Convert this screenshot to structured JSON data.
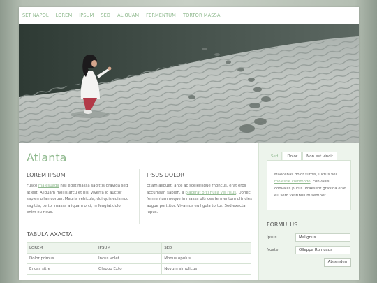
{
  "nav": {
    "items": [
      "SET NAPOL",
      "LOREM",
      "IPSUM",
      "SED",
      "ALIQUAM",
      "FERMENTUM",
      "TORTOR MASSA"
    ]
  },
  "main": {
    "title": "Atlanta",
    "col1": {
      "heading": "LOREM IPSUM",
      "t1": "Fusce ",
      "link": "malesuada",
      "t2": " nisi eget massa sagittis gravida sed at elit. Aliquam mollis arcu et nisi viverra id auctor sapien ullamcorper. Mauris vehicula, dui quis euismod sagittis, tortor massa aliquam orci, in feugiat dolor enim eu risus."
    },
    "col2": {
      "heading": "IPSUS DOLOR",
      "t1": "Etiam aliquet, ante ac scelerisque rhoncus, erat eros accumsan sapien, a ",
      "link": "placerat orci nulla vel risus",
      "t2": ". Donec fermentum neque in massa ultrices fermentum ultricies augue porttitor. Vivamus eu ligula tortor. Sed exacta lupus."
    },
    "table": {
      "title": "TABULA AXACTA",
      "headers": [
        "LOREM",
        "IPSUM",
        "SED"
      ],
      "rows": [
        [
          "Dolor primus",
          "Incus volet",
          "Monus opulus"
        ],
        [
          "Encas sitre",
          "Oleppo Exto",
          "Novum simplicus"
        ]
      ]
    }
  },
  "sidebar": {
    "tabs": [
      "Sed",
      "Dolor",
      "Non est vincit"
    ],
    "tab_text1": "Maecenas dolor turpis, luctus vel ",
    "tab_link": "molestie commodo",
    "tab_text2": ", convallis convallis purus. Praesent gravida erat eu sem vestibulum semper.",
    "form": {
      "title": "FORMULUS",
      "label1": "Ipsus",
      "value1": "Malignus",
      "label2": "Noxte",
      "value2": "Olleppa Rumusus",
      "button": "Absenden"
    }
  },
  "colors": {
    "accent": "#8fb98e",
    "panel": "#edf4ec"
  }
}
